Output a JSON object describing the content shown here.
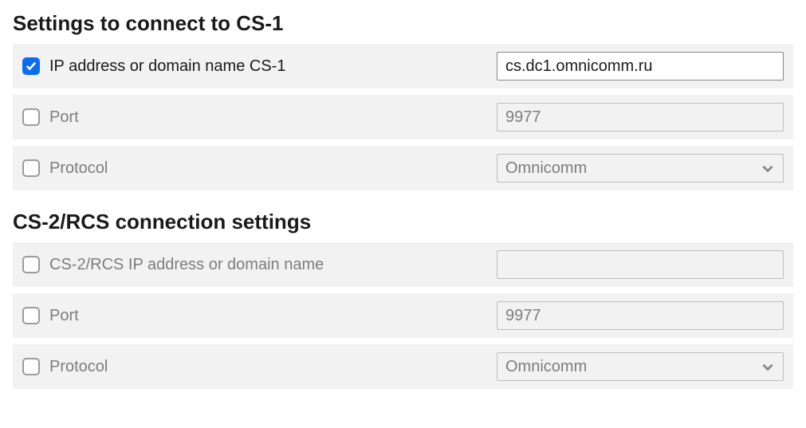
{
  "cs1": {
    "title": "Settings to connect to CS-1",
    "rows": [
      {
        "label": "IP address or domain name CS-1",
        "checked": true,
        "type": "text",
        "value": "cs.dc1.omnicomm.ru",
        "enabled": true
      },
      {
        "label": "Port",
        "checked": false,
        "type": "text",
        "value": "9977",
        "enabled": false
      },
      {
        "label": "Protocol",
        "checked": false,
        "type": "select",
        "value": "Omnicomm",
        "enabled": false
      }
    ]
  },
  "cs2": {
    "title": "CS-2/RCS connection settings",
    "rows": [
      {
        "label": "CS-2/RCS IP address or domain name",
        "checked": false,
        "type": "text",
        "value": "",
        "enabled": false
      },
      {
        "label": "Port",
        "checked": false,
        "type": "text",
        "value": "9977",
        "enabled": false
      },
      {
        "label": "Protocol",
        "checked": false,
        "type": "select",
        "value": "Omnicomm",
        "enabled": false
      }
    ]
  }
}
